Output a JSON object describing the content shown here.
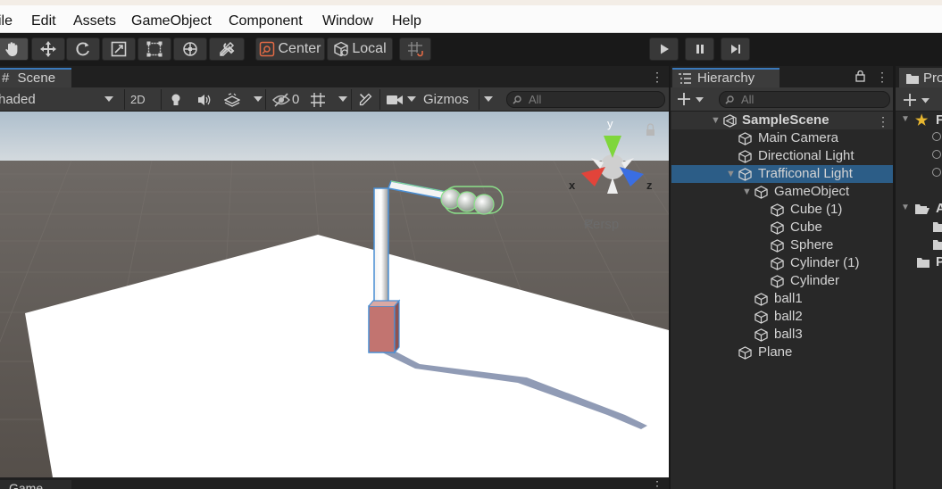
{
  "menu": {
    "items": [
      "ile",
      "Edit",
      "Assets",
      "GameObject",
      "Component",
      "Window",
      "Help"
    ]
  },
  "toolbar": {
    "tools": [
      "hand-tool",
      "move-tool",
      "rotate-tool",
      "scale-tool",
      "rect-tool",
      "transform-tool",
      "custom-tool"
    ],
    "pivot_label": "Center",
    "space_label": "Local",
    "play": "play",
    "pause": "pause",
    "step": "step"
  },
  "scene": {
    "tab_label": "Scene",
    "tab_prefix": "#",
    "draw_mode": "haded",
    "mode_2d": "2D",
    "hidden_count": "0",
    "gizmos_label": "Gizmos",
    "search_placeholder": "All",
    "persp_label": "Persp",
    "axis_x": "x",
    "axis_y": "y",
    "axis_z": "z",
    "colors": {
      "sky_top": "#c6d2db",
      "ground": "#5b5651",
      "plane": "#ffffff",
      "selection": "#4a8fd4",
      "collider": "#8be08a"
    }
  },
  "game": {
    "tab_label": "Game"
  },
  "hierarchy": {
    "tab_label": "Hierarchy",
    "search_placeholder": "All",
    "scene_name": "SampleScene",
    "items": [
      {
        "label": "Main Camera",
        "depth": 1,
        "expandable": false,
        "selected": false
      },
      {
        "label": "Directional Light",
        "depth": 1,
        "expandable": false,
        "selected": false
      },
      {
        "label": "Trafficonal Light",
        "depth": 1,
        "expandable": true,
        "selected": true
      },
      {
        "label": "GameObject",
        "depth": 2,
        "expandable": true,
        "selected": false
      },
      {
        "label": "Cube (1)",
        "depth": 3,
        "expandable": false,
        "selected": false
      },
      {
        "label": "Cube",
        "depth": 3,
        "expandable": false,
        "selected": false
      },
      {
        "label": "Sphere",
        "depth": 3,
        "expandable": false,
        "selected": false
      },
      {
        "label": "Cylinder (1)",
        "depth": 3,
        "expandable": false,
        "selected": false
      },
      {
        "label": "Cylinder",
        "depth": 3,
        "expandable": false,
        "selected": false
      },
      {
        "label": "ball1",
        "depth": 2,
        "expandable": false,
        "selected": false
      },
      {
        "label": "ball2",
        "depth": 2,
        "expandable": false,
        "selected": false
      },
      {
        "label": "ball3",
        "depth": 2,
        "expandable": false,
        "selected": false
      },
      {
        "label": "Plane",
        "depth": 1,
        "expandable": false,
        "selected": false
      }
    ]
  },
  "project": {
    "tab_label": "Pro",
    "rows": [
      "F",
      "A",
      "P"
    ]
  }
}
